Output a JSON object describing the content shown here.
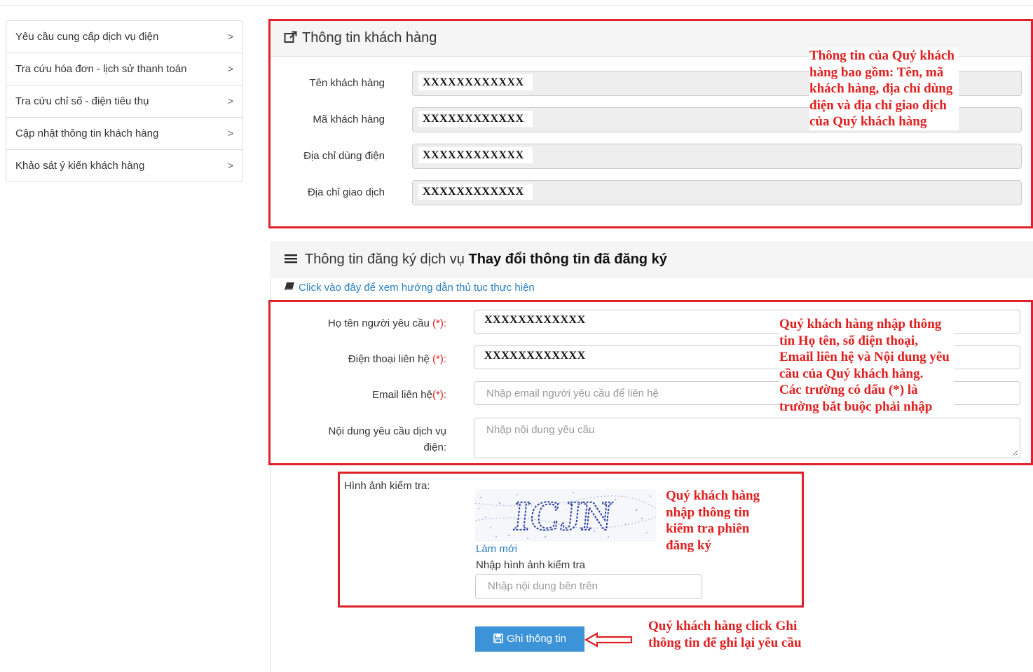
{
  "sidebar": {
    "items": [
      {
        "label": "Yêu cầu cung cấp dịch vụ điện",
        "chevron": ">"
      },
      {
        "label": "Tra cứu hóa đơn - lịch sử thanh toán",
        "chevron": ">"
      },
      {
        "label": "Tra cứu chỉ số - điện tiêu thụ",
        "chevron": ">"
      },
      {
        "label": "Cập nhật thông tin khách hàng",
        "chevron": ">"
      },
      {
        "label": "Khảo sát ý kiến khách hàng",
        "chevron": ">"
      }
    ]
  },
  "customer_panel": {
    "title": "Thông tin khách hàng",
    "icon": "external-link-icon",
    "fields": [
      {
        "label": "Tên khách hàng",
        "value": "XXXXXXXXXXXX"
      },
      {
        "label": "Mã khách hàng",
        "value": "XXXXXXXXXXXX"
      },
      {
        "label": "Địa chỉ dùng điện",
        "value": "XXXXXXXXXXXX"
      },
      {
        "label": "Địa chỉ giao dịch",
        "value": "XXXXXXXXXXXX"
      }
    ]
  },
  "service_panel": {
    "title_prefix": "Thông tin đăng ký dịch vụ",
    "title_bold": "Thay đổi thông tin đã đăng ký",
    "icon": "menu-icon",
    "guide_link": "Click vào đây để xem hướng dẫn thủ tục thực hiện",
    "guide_icon": "book-icon",
    "required_mark": "(*):",
    "fields": {
      "name": {
        "label": "Họ tên người yêu cầu",
        "value": "XXXXXXXXXXXX"
      },
      "phone": {
        "label": "Điện thoại liên hệ",
        "value": "XXXXXXXXXXXX"
      },
      "email": {
        "label": "Email liên hệ",
        "placeholder": "Nhập email người yêu cầu để liên hệ"
      },
      "content": {
        "label_line1": "Nội dung yêu cầu dịch vụ",
        "label_line2": "điện:",
        "placeholder": "Nhập nội dung yêu cầu"
      }
    }
  },
  "captcha": {
    "label": "Hình ảnh kiểm tra:",
    "text": "ICJN",
    "refresh": "Làm mới",
    "input_label": "Nhập hình ảnh kiểm tra",
    "input_placeholder": "Nhập nội dung bên trên"
  },
  "submit": {
    "label": "Ghi thông tin",
    "icon": "floppy-disk-icon"
  },
  "annotations": {
    "customer_info": [
      "Thông tin của Quý khách",
      "hàng bao gồm: Tên, mã",
      "khách hàng, địa chỉ dùng",
      "điện và địa chỉ giao dịch",
      "của Quý khách hàng"
    ],
    "request_info": [
      "Quý khách hàng nhập thông",
      "tin Họ tên, số điện thoại,",
      "Email liên hệ và Nội dung yêu",
      "cầu của Quý khách hàng.",
      "Các trường có dấu (*) là",
      "trường bắt buộc phải nhập"
    ],
    "captcha": [
      "Quý khách hàng",
      "nhập thông tin",
      "kiểm tra phiên",
      "đăng ký"
    ],
    "submit": [
      "Quý khách hàng click Ghi",
      "thông tin để ghi lại yêu cầu"
    ]
  },
  "colors": {
    "annotation_red": "#e02020",
    "button_blue": "#3c93d7",
    "link_blue": "#2a7fc1",
    "readonly_gray": "#eeeeee"
  }
}
